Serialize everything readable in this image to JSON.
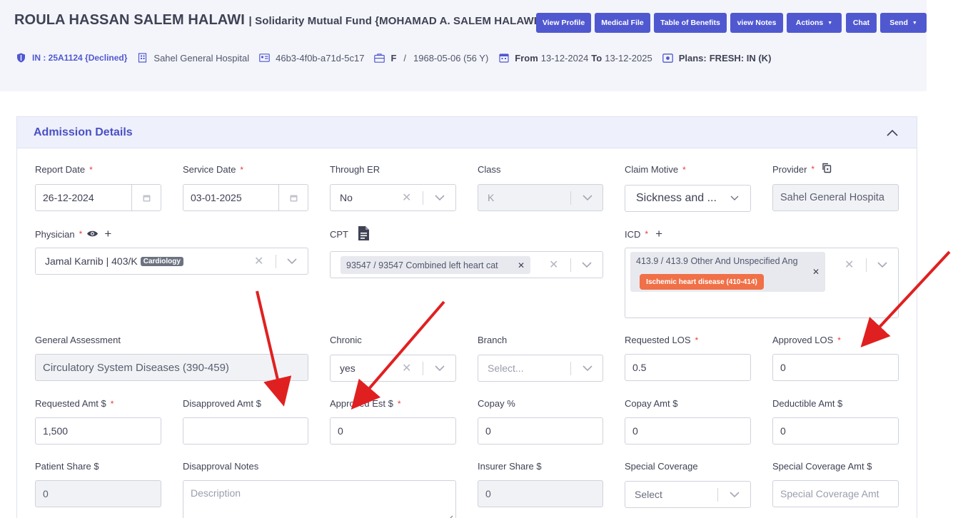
{
  "header": {
    "patient_name": "ROULA HASSAN SALEM HALAWI",
    "fund": "| Solidarity Mutual Fund {MOHAMAD A. SALEM HALAWI}",
    "buttons": {
      "view_profile": "View Profile",
      "medical_file": "Medical File",
      "table_of_benefits": "Table of Benefits",
      "view_notes": "view Notes",
      "actions": "Actions",
      "chat": "Chat",
      "send": "Send"
    },
    "info": {
      "in_status": "IN : 25A1124 {Declined}",
      "hospital": "Sahel General Hospital",
      "card_id": "46b3-4f0b-a71d-5c17",
      "gender": "F",
      "separator": "/",
      "dob_age": "1968-05-06 (56 Y)",
      "from_label": "From",
      "from_date": "13-12-2024",
      "to_label": "To",
      "to_date": "13-12-2025",
      "plans_label": "Plans:",
      "plans_value": "FRESH: IN (K)"
    }
  },
  "section": {
    "title": "Admission Details"
  },
  "fields": {
    "report_date": {
      "label": "Report Date",
      "value": "26-12-2024"
    },
    "service_date": {
      "label": "Service Date",
      "value": "03-01-2025"
    },
    "through_er": {
      "label": "Through ER",
      "value": "No"
    },
    "class": {
      "label": "Class",
      "value": "K"
    },
    "claim_motive": {
      "label": "Claim Motive",
      "value": "Sickness and ..."
    },
    "provider": {
      "label": "Provider",
      "value": "Sahel General Hospita"
    },
    "physician": {
      "label": "Physician",
      "value": "Jamal Karnib | 403/K",
      "badge": "Cardiology"
    },
    "cpt": {
      "label": "CPT",
      "value": "93547 / 93547 Combined left heart cat"
    },
    "icd": {
      "label": "ICD",
      "value": "413.9 / 413.9 Other And Unspecified Ang",
      "tag": "Ischemic heart disease (410-414)"
    },
    "general_assessment": {
      "label": "General Assessment",
      "value": "Circulatory System Diseases (390-459)"
    },
    "chronic": {
      "label": "Chronic",
      "value": "yes"
    },
    "branch": {
      "label": "Branch",
      "placeholder": "Select..."
    },
    "requested_los": {
      "label": "Requested LOS",
      "value": "0.5"
    },
    "approved_los": {
      "label": "Approved LOS",
      "value": "0"
    },
    "requested_amt": {
      "label": "Requested Amt $",
      "value": "1,500"
    },
    "disapproved_amt": {
      "label": "Disapproved Amt $",
      "value": ""
    },
    "approved_est": {
      "label": "Approved Est $",
      "value": "0"
    },
    "copay_pct": {
      "label": "Copay %",
      "value": "0"
    },
    "copay_amt": {
      "label": "Copay Amt $",
      "value": "0"
    },
    "deductible_amt": {
      "label": "Deductible Amt $",
      "value": "0"
    },
    "patient_share": {
      "label": "Patient Share $",
      "value": "0"
    },
    "disapproval_notes": {
      "label": "Disapproval Notes",
      "placeholder": "Description"
    },
    "insurer_share": {
      "label": "Insurer Share $",
      "value": "0"
    },
    "special_coverage": {
      "label": "Special Coverage",
      "placeholder": "Select"
    },
    "special_coverage_amt": {
      "label": "Special Coverage Amt $",
      "placeholder": "Special Coverage Amt"
    }
  },
  "required_mark": "*",
  "colors": {
    "primary": "#5058d0",
    "section_title": "#4a51c2",
    "required": "#e53e3e",
    "annotation_arrow": "#e02020",
    "icd_tag": "#f07047"
  }
}
